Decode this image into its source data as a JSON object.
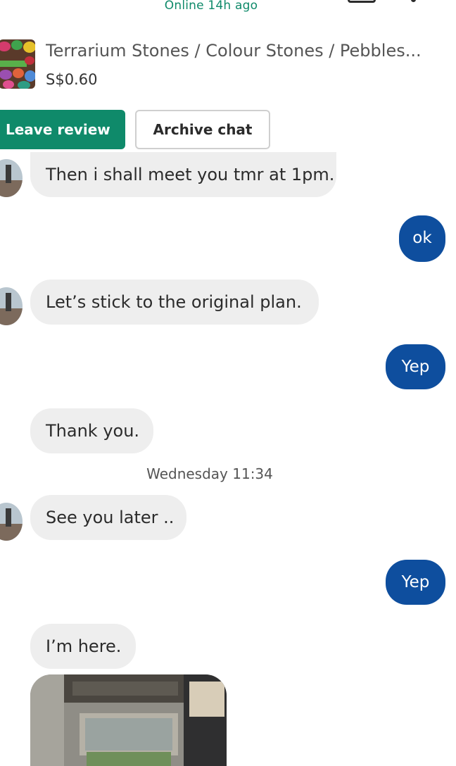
{
  "header": {
    "status": "Online 14h ago"
  },
  "listing": {
    "title": "Terrarium Stones / Colour Stones / Pebbles...",
    "price": "S$0.60"
  },
  "actions": {
    "leave_review": "Leave review",
    "archive_chat": "Archive chat"
  },
  "messages": [
    {
      "from": "seller",
      "text": "Then i shall meet you tmr at 1pm."
    },
    {
      "from": "me",
      "text": "ok"
    },
    {
      "from": "seller",
      "text": "Let’s stick to the original plan."
    },
    {
      "from": "me",
      "text": "Yep"
    },
    {
      "from": "seller",
      "text": "Thank you."
    },
    {
      "from": "seller",
      "text": "See you later .."
    },
    {
      "from": "me",
      "text": "Yep"
    },
    {
      "from": "seller",
      "text": "I’m here."
    }
  ],
  "timestamp": "Wednesday 11:34",
  "colors": {
    "accent_green": "#0f8a6a",
    "outgoing_blue": "#0e4e9e",
    "incoming_gray": "#eeeeee"
  },
  "icons": [
    "chat-list-icon",
    "more-options-icon"
  ]
}
